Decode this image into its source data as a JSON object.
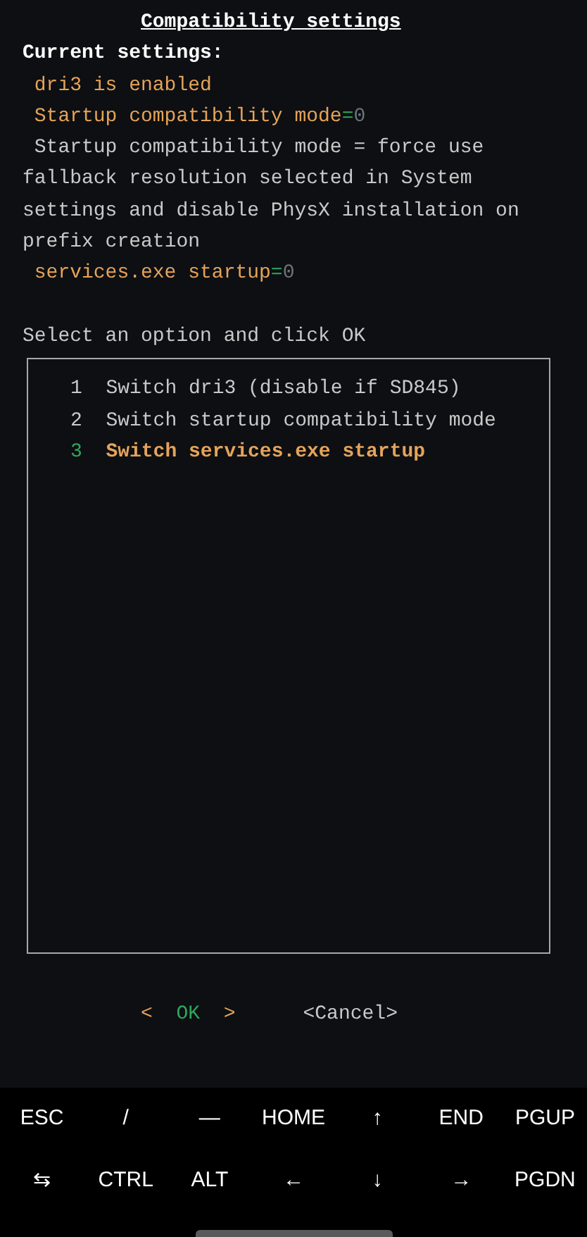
{
  "title": "Compatibility settings",
  "heading": "Current settings:",
  "status_lines": [
    {
      "kind": "flag",
      "text": "dri3 is enabled"
    },
    {
      "kind": "setting",
      "key": "Startup compatibility mode",
      "separator": "=",
      "value": "0"
    },
    {
      "kind": "note",
      "text": "Startup compatibility mode = force use fallback resolution selected in System settings and disable PhysX installation on prefix creation"
    },
    {
      "kind": "setting",
      "key": "services.exe startup",
      "separator": "=",
      "value": "0"
    }
  ],
  "prompt": "Select an option and click OK",
  "menu_items": [
    {
      "number": "1",
      "label": "Switch dri3 (disable if SD845)",
      "selected": false
    },
    {
      "number": "2",
      "label": "Switch startup compatibility mode",
      "selected": false
    },
    {
      "number": "3",
      "label": "Switch services.exe startup",
      "selected": true
    }
  ],
  "buttons": [
    {
      "open": "<",
      "label": "OK",
      "close": ">",
      "selected": true
    },
    {
      "open": "<",
      "label": "Cancel",
      "close": ">",
      "selected": false
    }
  ],
  "extra_keys": [
    [
      "ESC",
      "/",
      "—",
      "HOME",
      "↑",
      "END",
      "PGUP"
    ],
    [
      "⇆",
      "CTRL",
      "ALT",
      "←",
      "↓",
      "→",
      "PGDN"
    ]
  ]
}
